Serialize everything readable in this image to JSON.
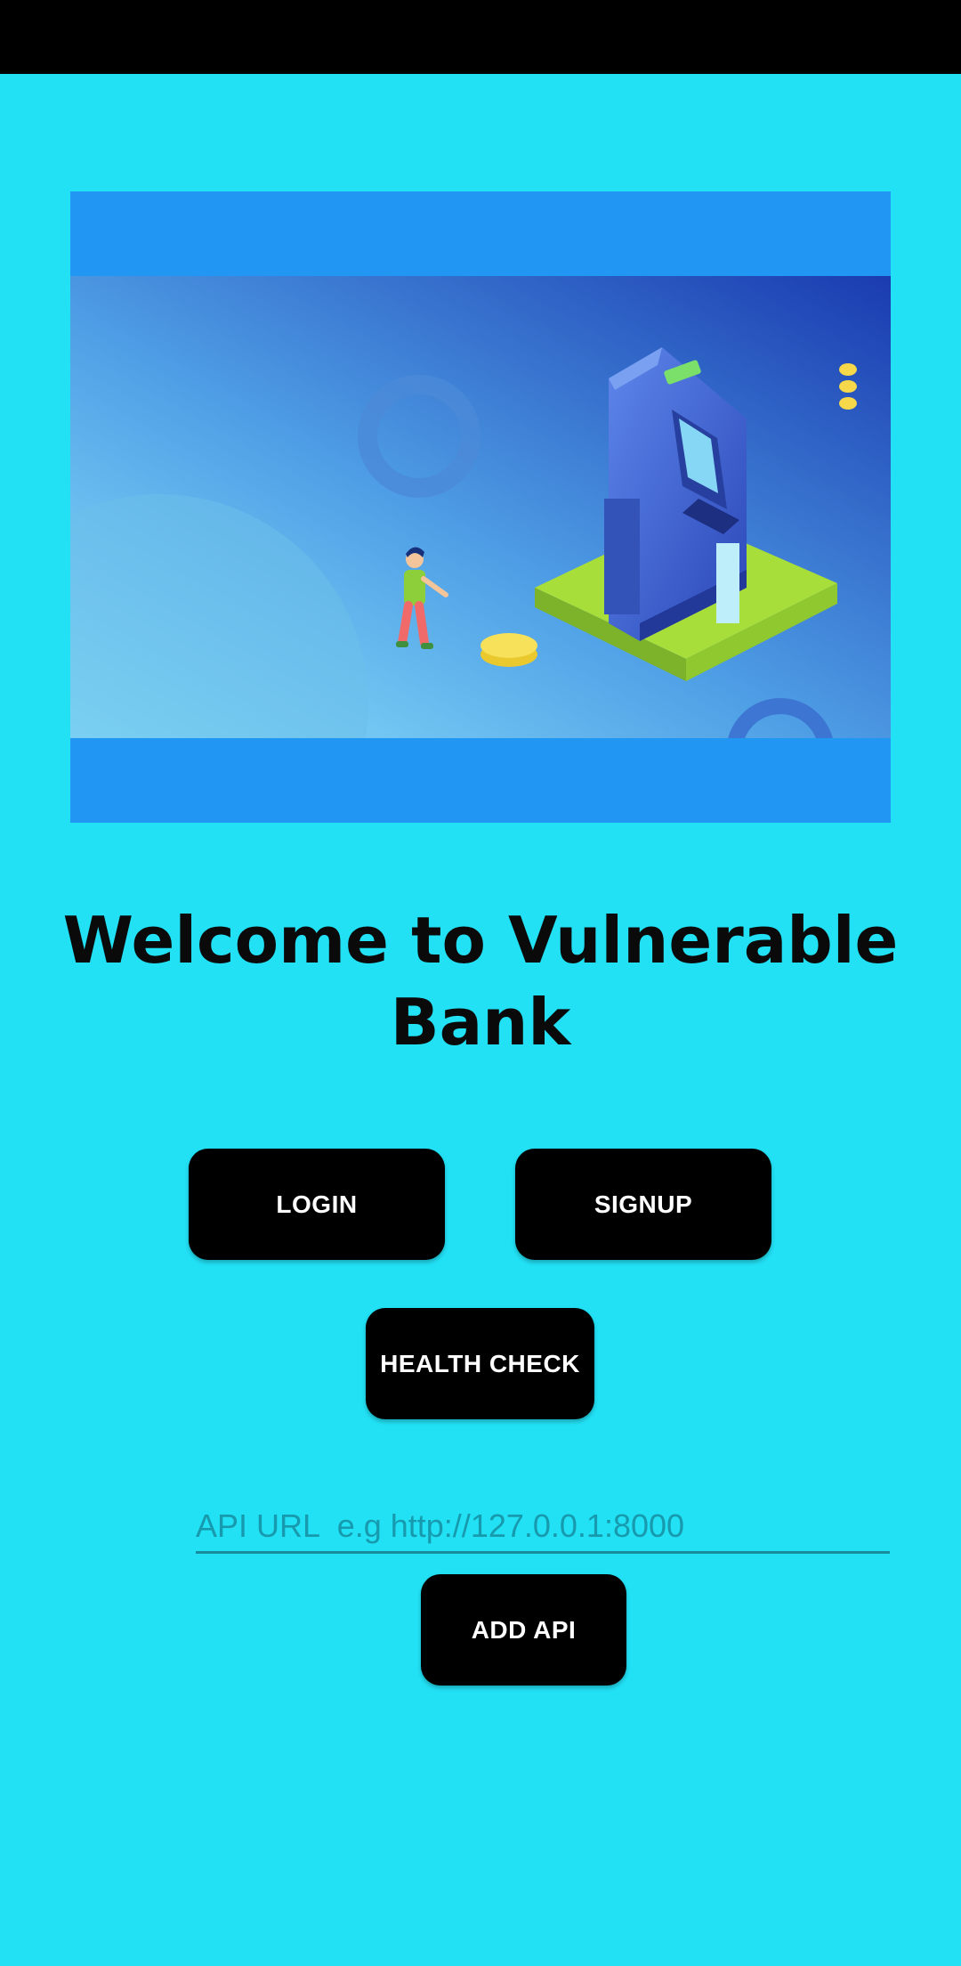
{
  "screen": {
    "background_color": "#22e1f5",
    "status_bar_color": "#000000"
  },
  "hero": {
    "frame_color": "#2196f3",
    "illustration": "bank-atm-illustration"
  },
  "welcome": {
    "title_line1": "Welcome to Vulnerable",
    "title_line2": "Bank"
  },
  "buttons": {
    "login": "LOGIN",
    "signup": "SIGNUP",
    "health_check": "HEALTH CHECK",
    "add_api": "ADD API"
  },
  "api_url": {
    "placeholder": "API URL  e.g http://127.0.0.1:8000",
    "value": ""
  }
}
